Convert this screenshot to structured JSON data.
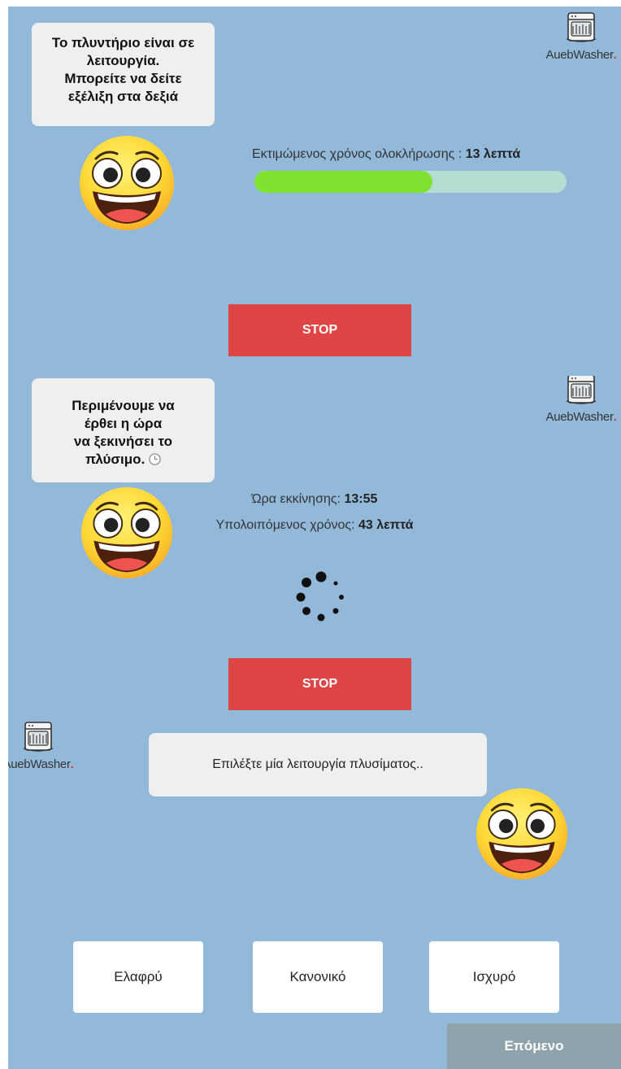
{
  "running_screen": {
    "bubble_lines": [
      "Το πλυντήριο είναι σε",
      "λειτουργία.",
      "Μπορείτε να δείτε",
      "εξέλιξη στα δεξιά"
    ],
    "logo_text": "AuebWasher",
    "estimate_label": "Εκτιμώμενος χρόνος ολοκλήρωσης : ",
    "estimate_value": "13 λεπτά",
    "progress_fraction": 0.57,
    "stop_label": "STOP"
  },
  "waiting_screen": {
    "bubble_lines": [
      "Περιμένουμε να",
      "έρθει η ώρα",
      "να ξεκινήσει το",
      "πλύσιμο."
    ],
    "logo_text": "AuebWasher",
    "start_time_label": "Ώρα εκκίνησης: ",
    "start_time_value": "13:55",
    "remaining_label": "Υπολοιπόμενος χρόνος: ",
    "remaining_value": "43 λεπτά",
    "stop_label": "STOP"
  },
  "select_screen": {
    "logo_text": "AuebWasher",
    "bubble_text": "Επιλέξτε μία λειτουργία πλυσίματος..",
    "modes": [
      "Ελαφρύ",
      "Κανονικό",
      "Ισχυρό"
    ],
    "next_label": "Επόμενο"
  },
  "colors": {
    "background": "#93b9da",
    "stop_button": "#df4545",
    "progress_fill": "#7fe22f",
    "progress_track": "#b5ddd1",
    "next_button": "#8fa3ad",
    "brand_dot": "#e53935"
  },
  "icons": [
    "dishwasher-logo-icon",
    "smiley-emoji-icon",
    "clock-icon",
    "loading-spinner-icon"
  ]
}
